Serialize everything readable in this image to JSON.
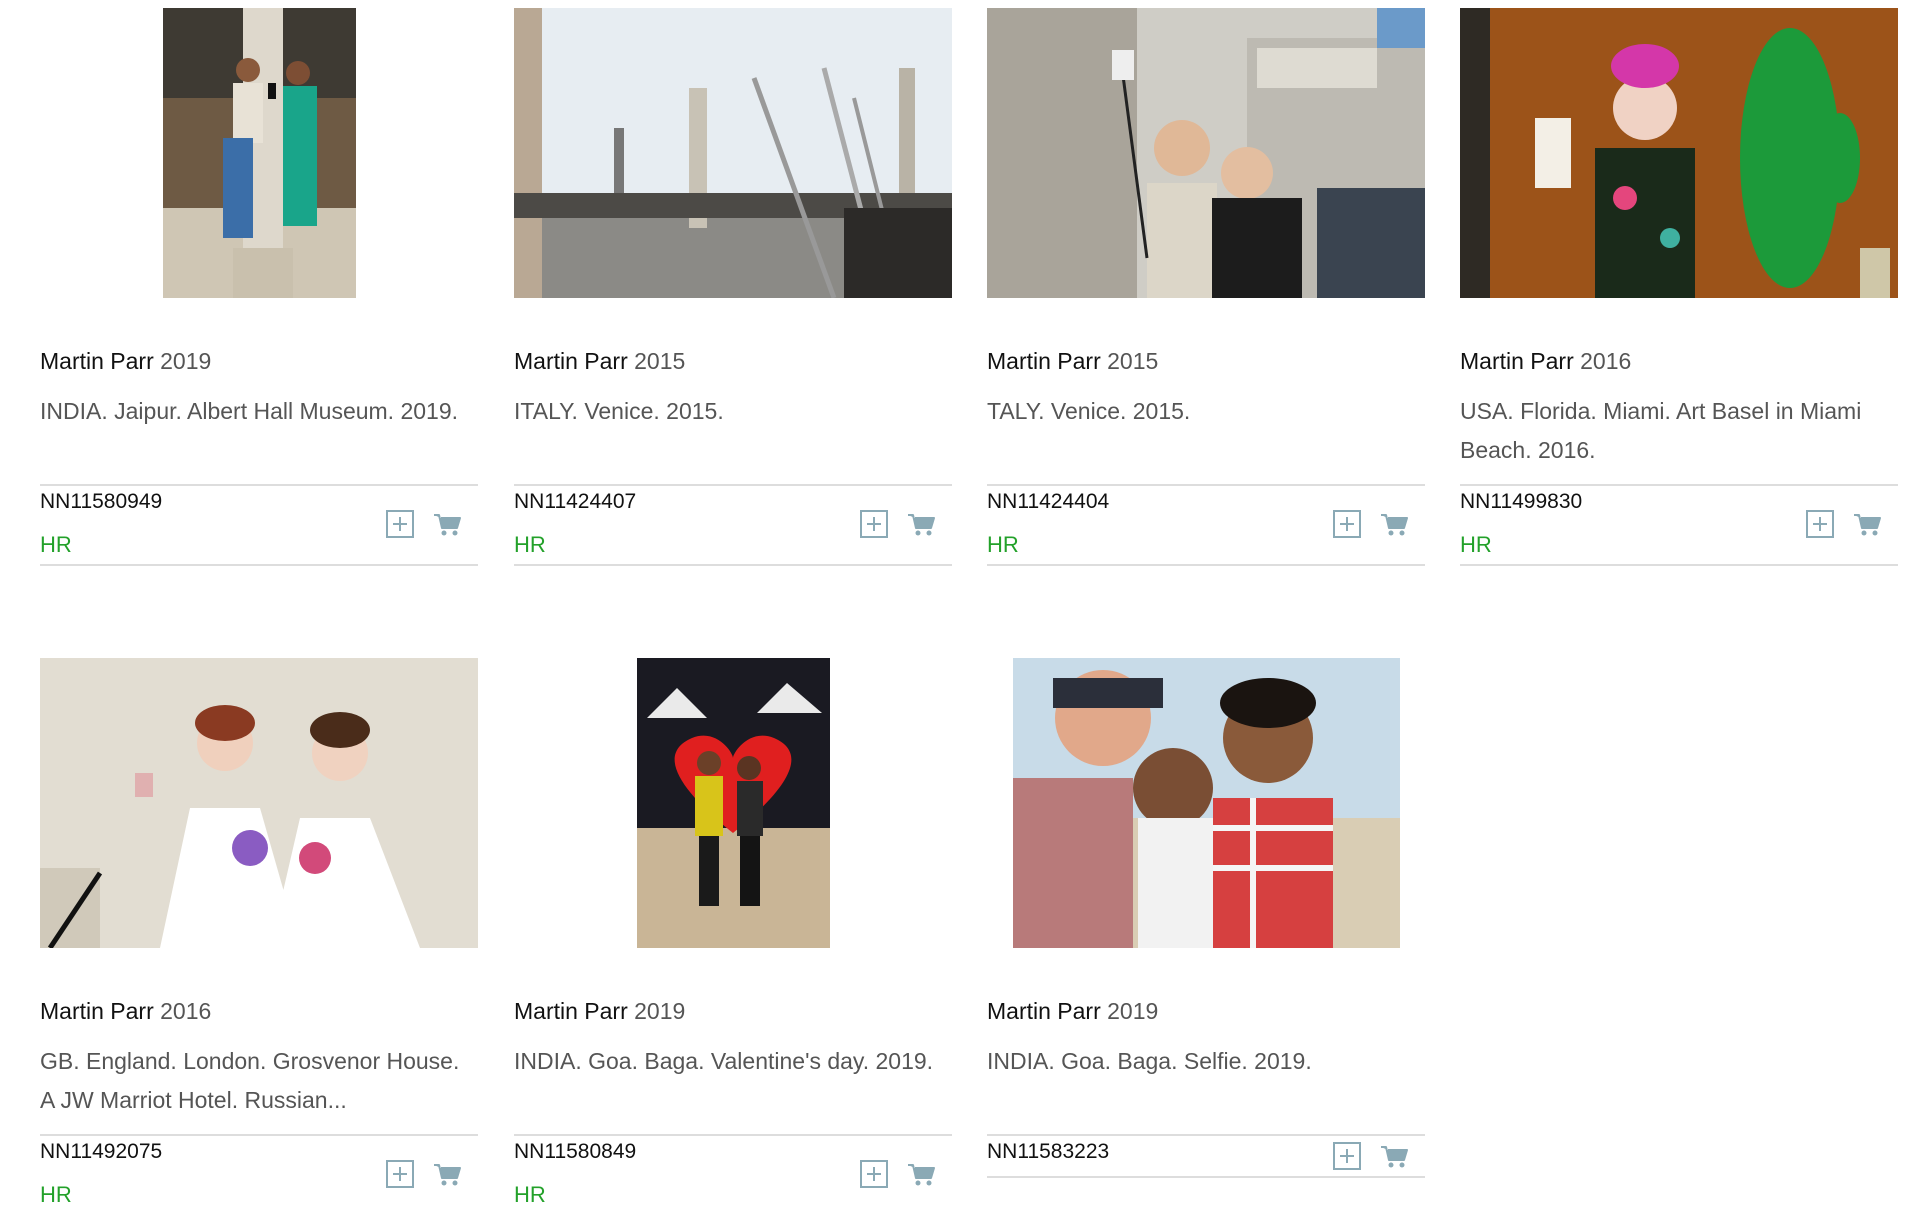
{
  "cards": [
    {
      "author": "Martin Parr",
      "year": "2019",
      "caption": "INDIA. Jaipur. Albert Hall Museum. 2019.",
      "ref": "NN11580949",
      "res": "HR",
      "image": "photo-selfie-couple-museum"
    },
    {
      "author": "Martin Parr",
      "year": "2015",
      "caption": "ITALY. Venice. 2015.",
      "ref": "NN11424407",
      "res": "HR",
      "image": "photo-selfie-sticks-piazza"
    },
    {
      "author": "Martin Parr",
      "year": "2015",
      "caption": "TALY. Venice. 2015.",
      "ref": "NN11424404",
      "res": "HR",
      "image": "photo-selfie-bridge-of-sighs"
    },
    {
      "author": "Martin Parr",
      "year": "2016",
      "caption": "USA. Florida. Miami. Art Basel in Miami Beach. 2016.",
      "ref": "NN11499830",
      "res": "HR",
      "image": "photo-woman-cactus"
    },
    {
      "author": "Martin Parr",
      "year": "2016",
      "caption": "GB. England. London. Grosvenor House. A JW Marriot Hotel. Russian...",
      "ref": "NN11492075",
      "res": "HR",
      "image": "photo-debutantes-selfie"
    },
    {
      "author": "Martin Parr",
      "year": "2019",
      "caption": "INDIA. Goa. Baga. Valentine's day. 2019.",
      "ref": "NN11580849",
      "res": "HR",
      "image": "photo-valentine-heart"
    },
    {
      "author": "Martin Parr",
      "year": "2019",
      "caption": "INDIA. Goa. Baga. Selfie. 2019.",
      "ref": "NN11583223",
      "res": "",
      "image": "photo-group-selfie-beach"
    }
  ],
  "icons": {
    "add": "plus-square-icon",
    "cart": "shopping-cart-icon"
  },
  "colors": {
    "resolution_badge": "#23a12a",
    "icon": "#8aa9b5",
    "divider": "#dddddd"
  }
}
